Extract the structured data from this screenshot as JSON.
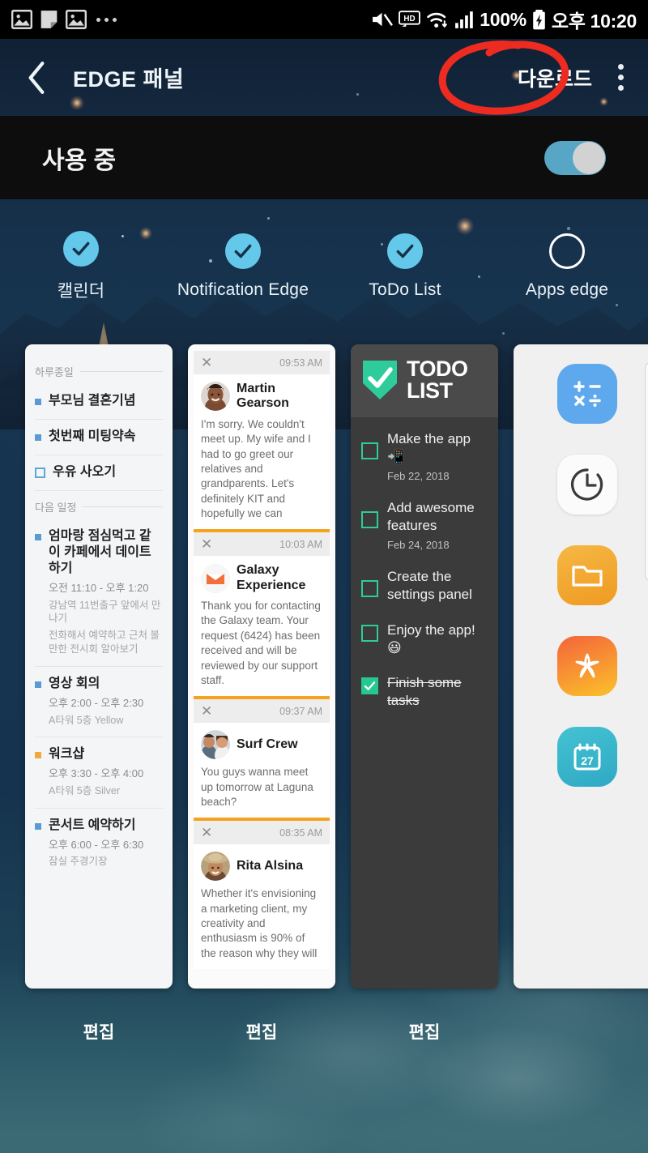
{
  "status_bar": {
    "icons": [
      "image-icon",
      "note-icon",
      "image-icon",
      "more-dots-icon"
    ],
    "mute_icon": "mute-icon",
    "hd_label": "HD",
    "wifi_icon": "wifi-icon",
    "signal_icon": "signal-bars-icon",
    "battery_percent": "100%",
    "battery_icon": "battery-charging-icon",
    "time": "오후 10:20"
  },
  "header": {
    "back_icon": "back-chevron-icon",
    "title": "EDGE 패널",
    "download_label": "다운로드",
    "menu_icon": "kebab-menu-icon",
    "annotation_color": "#ee2b20"
  },
  "use_bar": {
    "label": "사용 중",
    "toggle_on": true,
    "toggle_track_color": "#58a6c6",
    "toggle_knob_color": "#d2d2d2"
  },
  "tabs": [
    {
      "label": "캘린더",
      "checked": true
    },
    {
      "label": "Notification Edge",
      "checked": true
    },
    {
      "label": "ToDo List",
      "checked": true
    },
    {
      "label": "Apps edge",
      "checked": false
    }
  ],
  "calendar_panel": {
    "sections": [
      {
        "heading": "하루종일",
        "items": [
          {
            "title": "부모님 결혼기념",
            "bullet": "blue",
            "time": "",
            "notes": []
          },
          {
            "title": "첫번째 미팅약속",
            "bullet": "blue",
            "time": "",
            "notes": []
          },
          {
            "title": "우유 사오기",
            "bullet": "hollow",
            "time": "",
            "notes": []
          }
        ]
      },
      {
        "heading": "다음 일정",
        "items": [
          {
            "title": "엄마랑 점심먹고 같이 카페에서 데이트 하기",
            "bullet": "blue",
            "time": "오전 11:10 - 오후 1:20",
            "notes": [
              "강남역 11번출구 앞에서 만나기",
              "전화해서 예약하고 근처 볼 만한 전시회 알아보기"
            ]
          },
          {
            "title": "영상 회의",
            "bullet": "blue",
            "time": "오후 2:00 - 오후 2:30",
            "notes": [
              "A타워 5층 Yellow"
            ]
          },
          {
            "title": "워크샵",
            "bullet": "orange",
            "time": "오후 3:30 - 오후 4:00",
            "notes": [
              "A타워 5층 Silver"
            ]
          },
          {
            "title": "콘서트 예약하기",
            "bullet": "blue",
            "time": "오후 6:00 - 오후 6:30",
            "notes": [
              "잠실 주경기장"
            ]
          }
        ]
      }
    ]
  },
  "notification_panel": {
    "close_icon": "close-x-icon",
    "items": [
      {
        "time": "09:53 AM",
        "sender": "Martin Gearson",
        "avatar": "person-photo-avatar",
        "text": "I'm sorry. We couldn't meet up. My wife and I had to go greet our relatives and grandparents. Let's definitely KIT and hopefully we can"
      },
      {
        "time": "10:03 AM",
        "sender": "Galaxy Experience",
        "avatar": "email-envelope-icon",
        "text": "Thank you for contacting the Galaxy team. Your request (6424) has been received and will be reviewed by our support staff."
      },
      {
        "time": "09:37 AM",
        "sender": "Surf Crew",
        "avatar": "couple-photo-avatar",
        "text": "You guys wanna meet up tomorrow at Laguna beach?"
      },
      {
        "time": "08:35 AM",
        "sender": "Rita Alsina",
        "avatar": "woman-hat-photo-avatar",
        "text": "Whether it's envisioning a marketing client, my creativity and enthusiasm is 90% of the reason why they will"
      }
    ]
  },
  "todo_panel": {
    "brand_line1": "TODO",
    "brand_line2": "LIST",
    "logo_icon": "shield-check-icon",
    "accent_color": "#25c88f",
    "items": [
      {
        "text": "Make the app 📲",
        "date": "Feb 22, 2018",
        "done": false
      },
      {
        "text": "Add awesome features",
        "date": "Feb 24, 2018",
        "done": false
      },
      {
        "text": "Create the settings panel",
        "date": "",
        "done": false
      },
      {
        "text": "Enjoy the app! 😃",
        "date": "",
        "done": false
      },
      {
        "text": "Finish some tasks",
        "date": "",
        "done": true
      }
    ]
  },
  "apps_panel": {
    "apps": [
      {
        "name": "calculator-icon",
        "color": "#5ea9ee"
      },
      {
        "name": "clock-icon",
        "color": "#fbfbfb"
      },
      {
        "name": "files-folder-icon",
        "color": "#f2a830"
      },
      {
        "name": "gallery-flower-icon",
        "color": "#f79a33"
      },
      {
        "name": "calendar-icon",
        "color": "#3ab9ce",
        "day": "27"
      }
    ]
  },
  "edit_buttons": [
    {
      "label": "편집"
    },
    {
      "label": "편집"
    },
    {
      "label": "편집"
    }
  ]
}
